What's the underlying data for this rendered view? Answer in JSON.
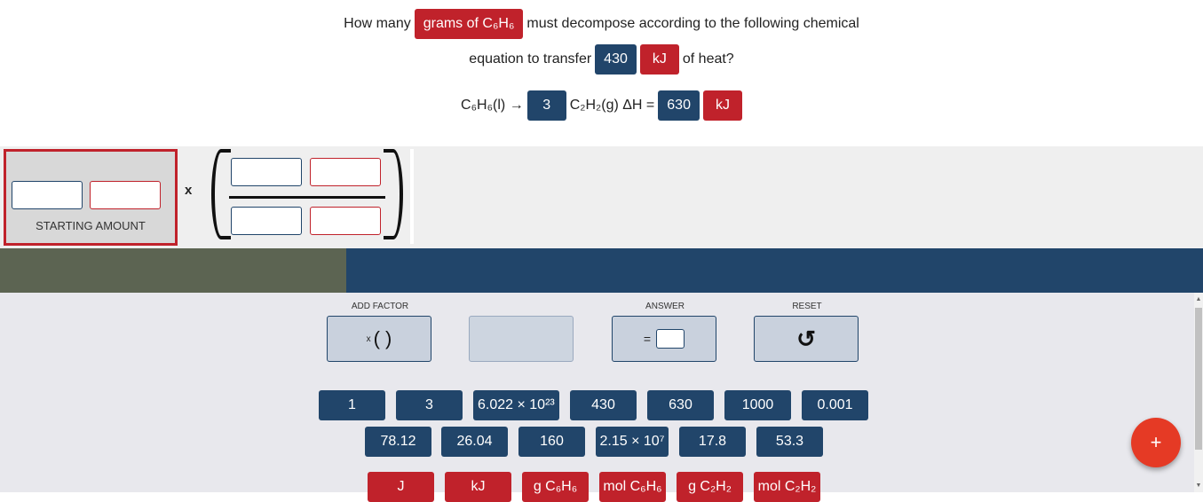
{
  "question": {
    "prefix": "How many",
    "unknown": "grams of C₆H₆",
    "suffix1": "must decompose according to the following chemical",
    "line2_prefix": "equation to transfer",
    "heat_value": "430",
    "heat_unit": "kJ",
    "line2_suffix": "of heat?",
    "reactant": "C₆H₆(l) →",
    "coefficient": "3",
    "product": "C₂H₂(g) ΔH =",
    "dh_value": "630",
    "dh_unit": "kJ"
  },
  "workspace": {
    "starting_amount_label": "STARTING AMOUNT",
    "times_symbol": "x"
  },
  "toolbar": {
    "add_factor_label": "ADD FACTOR",
    "add_factor_icon_text": "( )",
    "add_factor_times": "x",
    "answer_label": "ANSWER",
    "answer_equals": "=",
    "reset_label": "RESET",
    "reset_icon": "↺"
  },
  "tiles": {
    "row1": [
      "1",
      "3",
      "6.022 × 10²³",
      "430",
      "630",
      "1000",
      "0.001"
    ],
    "row2": [
      "78.12",
      "26.04",
      "160",
      "2.15 × 10⁷",
      "17.8",
      "53.3"
    ],
    "row3": [
      "J",
      "kJ",
      "g C₆H₆",
      "mol C₆H₆",
      "g C₂H₂",
      "mol C₂H₂"
    ]
  },
  "fab": {
    "label": "+"
  },
  "colors": {
    "red": "#c0222b",
    "blue": "#21456a",
    "fab": "#e53a25"
  }
}
